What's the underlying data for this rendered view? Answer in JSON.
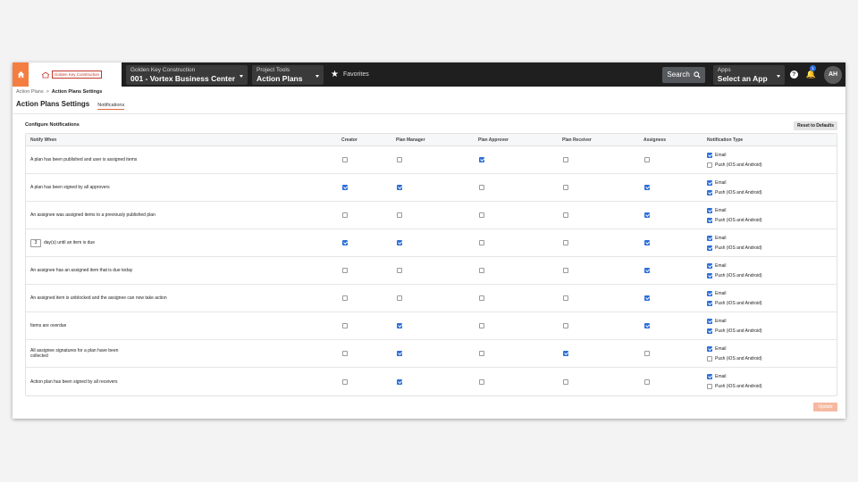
{
  "nav": {
    "logo_text": "Golden Key Construction",
    "company": {
      "label": "Golden Key Construction",
      "value": "001 - Vortex Business Center"
    },
    "tools": {
      "label": "Project Tools",
      "value": "Action Plans"
    },
    "favorites": "Favorites",
    "search": "Search",
    "apps": {
      "label": "Apps",
      "value": "Select an App"
    },
    "notification_count": "1",
    "avatar_initials": "AH"
  },
  "breadcrumb": {
    "parent": "Action Plans",
    "separator": ">",
    "current": "Action Plans Settings"
  },
  "page_title": "Action Plans Settings",
  "active_tab": "Notifications",
  "section_title": "Configure Notifications",
  "reset_label": "Reset to Defaults",
  "update_label": "Update",
  "columns": [
    "Notify When",
    "Creator",
    "Plan Manager",
    "Plan Approver",
    "Plan Receiver",
    "Assignees",
    "Notification Type"
  ],
  "type_labels": {
    "email": "Email",
    "push": "Push (iOS and Android)"
  },
  "rows": [
    {
      "text": "A plan has been published and user is assigned items",
      "checks": [
        false,
        false,
        true,
        false,
        false
      ],
      "email": true,
      "push": false
    },
    {
      "text": "A plan has been signed by all approvers",
      "checks": [
        true,
        true,
        false,
        false,
        true
      ],
      "email": true,
      "push": true
    },
    {
      "text": "An assignee was assigned items to a previously published plan",
      "checks": [
        false,
        false,
        false,
        false,
        true
      ],
      "email": true,
      "push": true
    },
    {
      "text": "day(s) until an item is due",
      "days": "3",
      "checks": [
        true,
        true,
        false,
        false,
        true
      ],
      "email": true,
      "push": true
    },
    {
      "text": "An assignee has an assigned item that is due today",
      "checks": [
        false,
        false,
        false,
        false,
        true
      ],
      "email": true,
      "push": true
    },
    {
      "text": "An assigned item is unblocked and the assignee can now take action",
      "checks": [
        false,
        false,
        false,
        false,
        true
      ],
      "email": true,
      "push": true
    },
    {
      "text": "Items are overdue",
      "checks": [
        false,
        true,
        false,
        false,
        true
      ],
      "email": true,
      "push": true
    },
    {
      "text": "All assignee signatures for a plan have been collected",
      "checks": [
        false,
        true,
        false,
        true,
        false
      ],
      "email": true,
      "push": false
    },
    {
      "text": "Action plan has been signed by all receivers",
      "checks": [
        false,
        true,
        false,
        false,
        false
      ],
      "email": true,
      "push": false
    }
  ]
}
